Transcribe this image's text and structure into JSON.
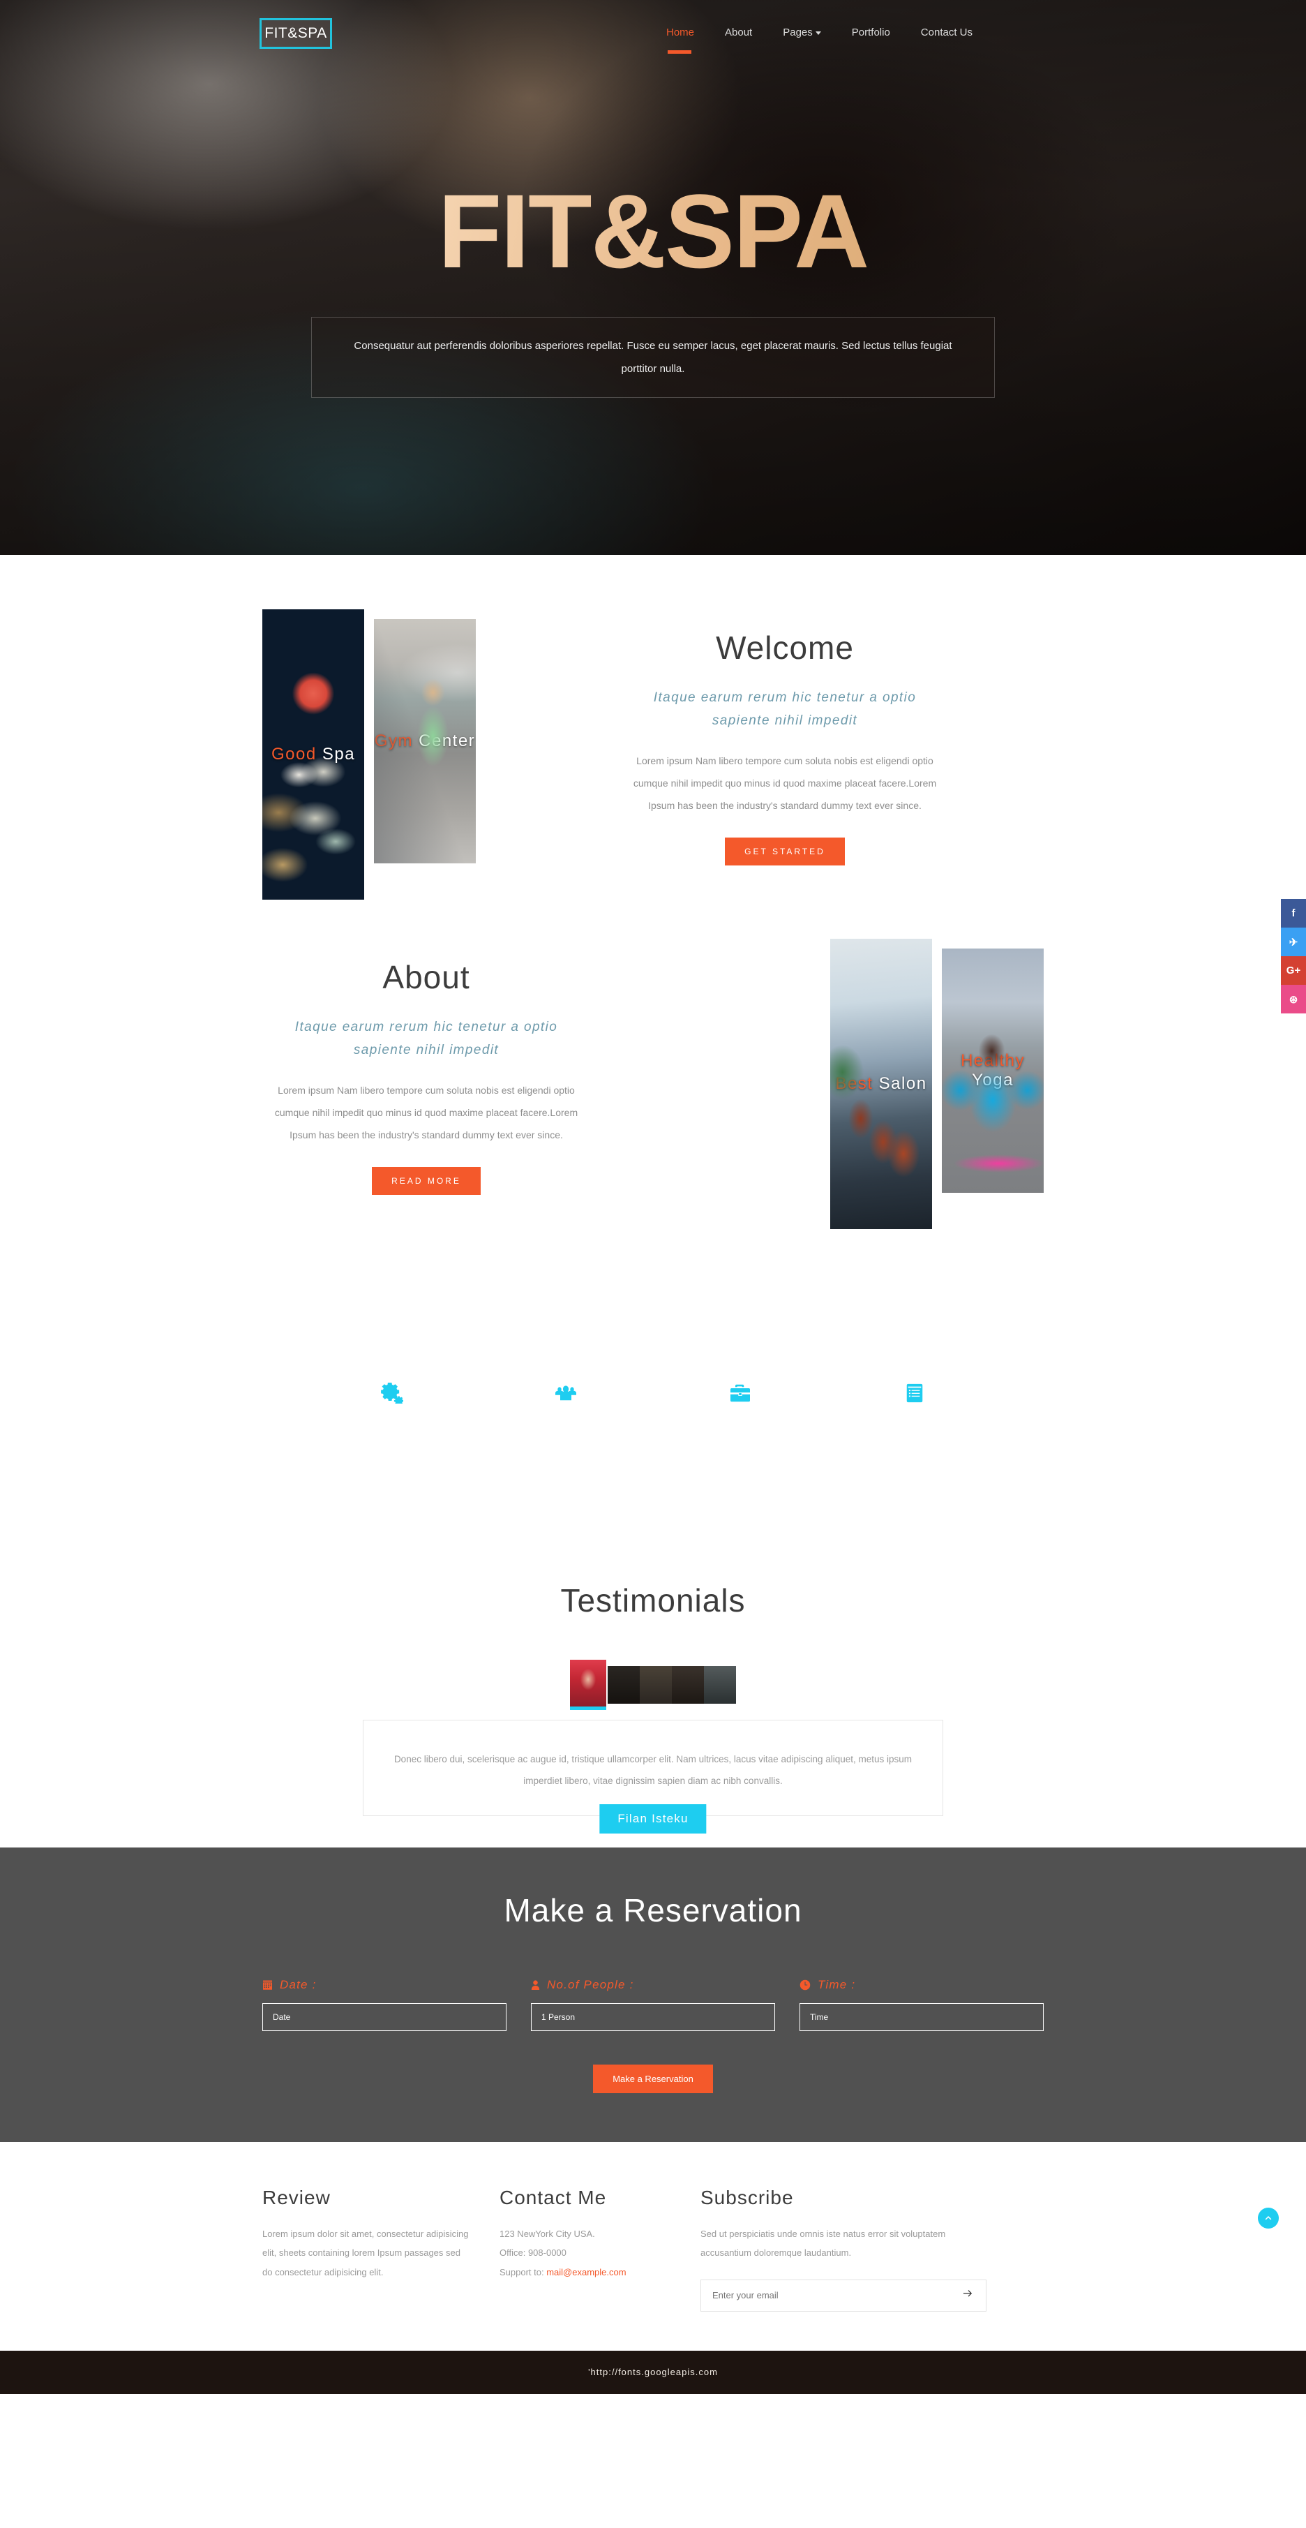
{
  "brand": {
    "logo": "FIT&SPA"
  },
  "colors": {
    "accent": "#f4592b",
    "cyan": "#1ecdf0",
    "gray_section": "#515151",
    "muted": "#9a9a9a",
    "subtitle": "#6d9aab"
  },
  "nav": {
    "items": [
      {
        "label": "Home",
        "active": true
      },
      {
        "label": "About",
        "active": false
      },
      {
        "label": "Pages",
        "active": false,
        "has_dropdown": true
      },
      {
        "label": "Portfolio",
        "active": false
      },
      {
        "label": "Contact Us",
        "active": false
      }
    ]
  },
  "hero": {
    "title": "FIT&SPA",
    "description": "Consequatur aut perferendis doloribus asperiores repellat. Fusce eu semper lacus, eget placerat mauris. Sed lectus tellus feugiat porttitor nulla."
  },
  "social": [
    {
      "name": "facebook-icon",
      "glyph": "f"
    },
    {
      "name": "twitter-icon",
      "glyph": "✈"
    },
    {
      "name": "google-plus-icon",
      "glyph": "G+"
    },
    {
      "name": "dribbble-icon",
      "glyph": "⊛"
    }
  ],
  "welcome": {
    "title": "Welcome",
    "subtitle": "Itaque earum rerum hic tenetur a optio sapiente nihil impedit",
    "body": "Lorem ipsum Nam libero tempore cum soluta nobis est eligendi optio cumque nihil impedit quo minus id quod maxime placeat facere.Lorem Ipsum has been the industry's standard dummy text ever since.",
    "button": "GET STARTED",
    "cards": [
      {
        "word1": "Good",
        "word2": "Spa"
      },
      {
        "word1": "Gym",
        "word2": "Center"
      }
    ]
  },
  "about": {
    "title": "About",
    "subtitle": "Itaque earum rerum hic tenetur a optio sapiente nihil impedit",
    "body": "Lorem ipsum Nam libero tempore cum soluta nobis est eligendi optio cumque nihil impedit quo minus id quod maxime placeat facere.Lorem Ipsum has been the industry's standard dummy text ever since.",
    "button": "READ MORE",
    "cards": [
      {
        "word1": "Best",
        "word2": "Salon"
      },
      {
        "word1": "Healthy",
        "word2": "Yoga"
      }
    ]
  },
  "features": {
    "icons": [
      "cogs-icon",
      "users-icon",
      "briefcase-icon",
      "list-alt-icon"
    ]
  },
  "testimonials": {
    "title": "Testimonials",
    "quote": "Donec libero dui, scelerisque ac augue id, tristique ullamcorper elit. Nam ultrices, lacus vitae adipiscing aliquet, metus ipsum imperdiet libero, vitae dignissim sapien diam ac nibh convallis.",
    "name": "Filan Isteku",
    "thumb_count": 5
  },
  "reservation": {
    "title": "Make a Reservation",
    "fields": [
      {
        "icon": "calendar-icon",
        "label": "Date :",
        "placeholder": "Date"
      },
      {
        "icon": "user-icon",
        "label": "No.of People :",
        "placeholder": "1 Person"
      },
      {
        "icon": "clock-icon",
        "label": "Time :",
        "placeholder": "Time"
      }
    ],
    "button": "Make a Reservation"
  },
  "footer": {
    "review": {
      "title": "Review",
      "body": "Lorem ipsum dolor sit amet, consectetur adipisicing elit, sheets containing lorem Ipsum passages sed do consectetur adipisicing elit."
    },
    "contact": {
      "title": "Contact Me",
      "address": "123 NewYork City USA.",
      "office": "Office: 908-0000",
      "support_prefix": "Support to: ",
      "email": "mail@example.com"
    },
    "subscribe": {
      "title": "Subscribe",
      "body": "Sed ut perspiciatis unde omnis iste natus error sit voluptatem accusantium doloremque laudantium.",
      "placeholder": "Enter your email",
      "submit_icon": "arrow-right-icon"
    },
    "to_top_icon": "chevron-up-icon"
  },
  "bottom_bar": {
    "text": "'http://fonts.googleapis.com"
  }
}
